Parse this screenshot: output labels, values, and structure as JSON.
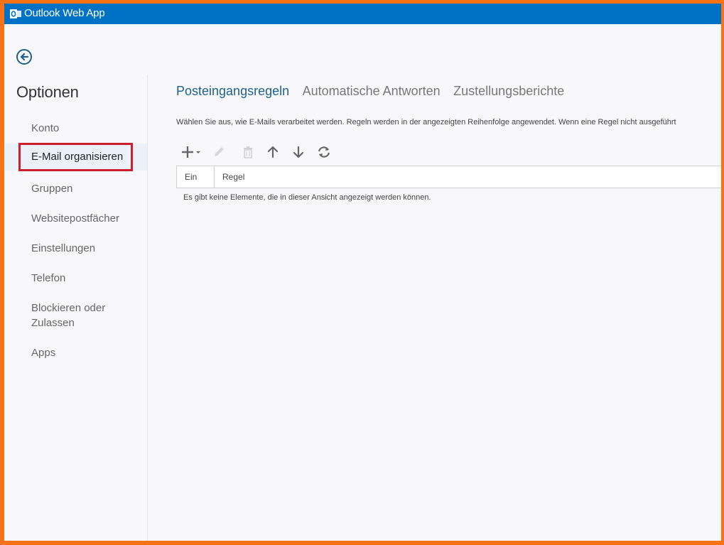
{
  "header": {
    "app_title": "Outlook Web App",
    "brand_color": "#0072c6"
  },
  "sidebar": {
    "title": "Optionen",
    "items": [
      {
        "label": "Konto",
        "selected": false
      },
      {
        "label": "E-Mail organisieren",
        "selected": true
      },
      {
        "label": "Gruppen",
        "selected": false
      },
      {
        "label": "Websitepostfächer",
        "selected": false
      },
      {
        "label": "Einstellungen",
        "selected": false
      },
      {
        "label": "Telefon",
        "selected": false
      },
      {
        "label": "Blockieren oder Zulassen",
        "line1": "Blockieren oder",
        "line2": "Zulassen",
        "selected": false
      },
      {
        "label": "Apps",
        "selected": false
      }
    ]
  },
  "main": {
    "tabs": [
      {
        "label": "Posteingangsregeln",
        "active": true
      },
      {
        "label": "Automatische Antworten",
        "active": false
      },
      {
        "label": "Zustellungsberichte",
        "active": false
      }
    ],
    "description": "Wählen Sie aus, wie E-Mails verarbeitet werden. Regeln werden in der angezeigten Reihenfolge angewendet. Wenn eine Regel nicht ausgeführt",
    "toolbar_icons": [
      "add-icon",
      "edit-icon",
      "delete-icon",
      "move-up-icon",
      "move-down-icon",
      "refresh-icon"
    ],
    "table": {
      "columns": [
        "Ein",
        "Regel"
      ],
      "empty_message": "Es gibt keine Elemente, die in dieser Ansicht angezeigt werden können."
    }
  },
  "colors": {
    "accent": "#0072c6",
    "highlight_border": "#cc1f2e",
    "outer_frame": "#f97316"
  }
}
